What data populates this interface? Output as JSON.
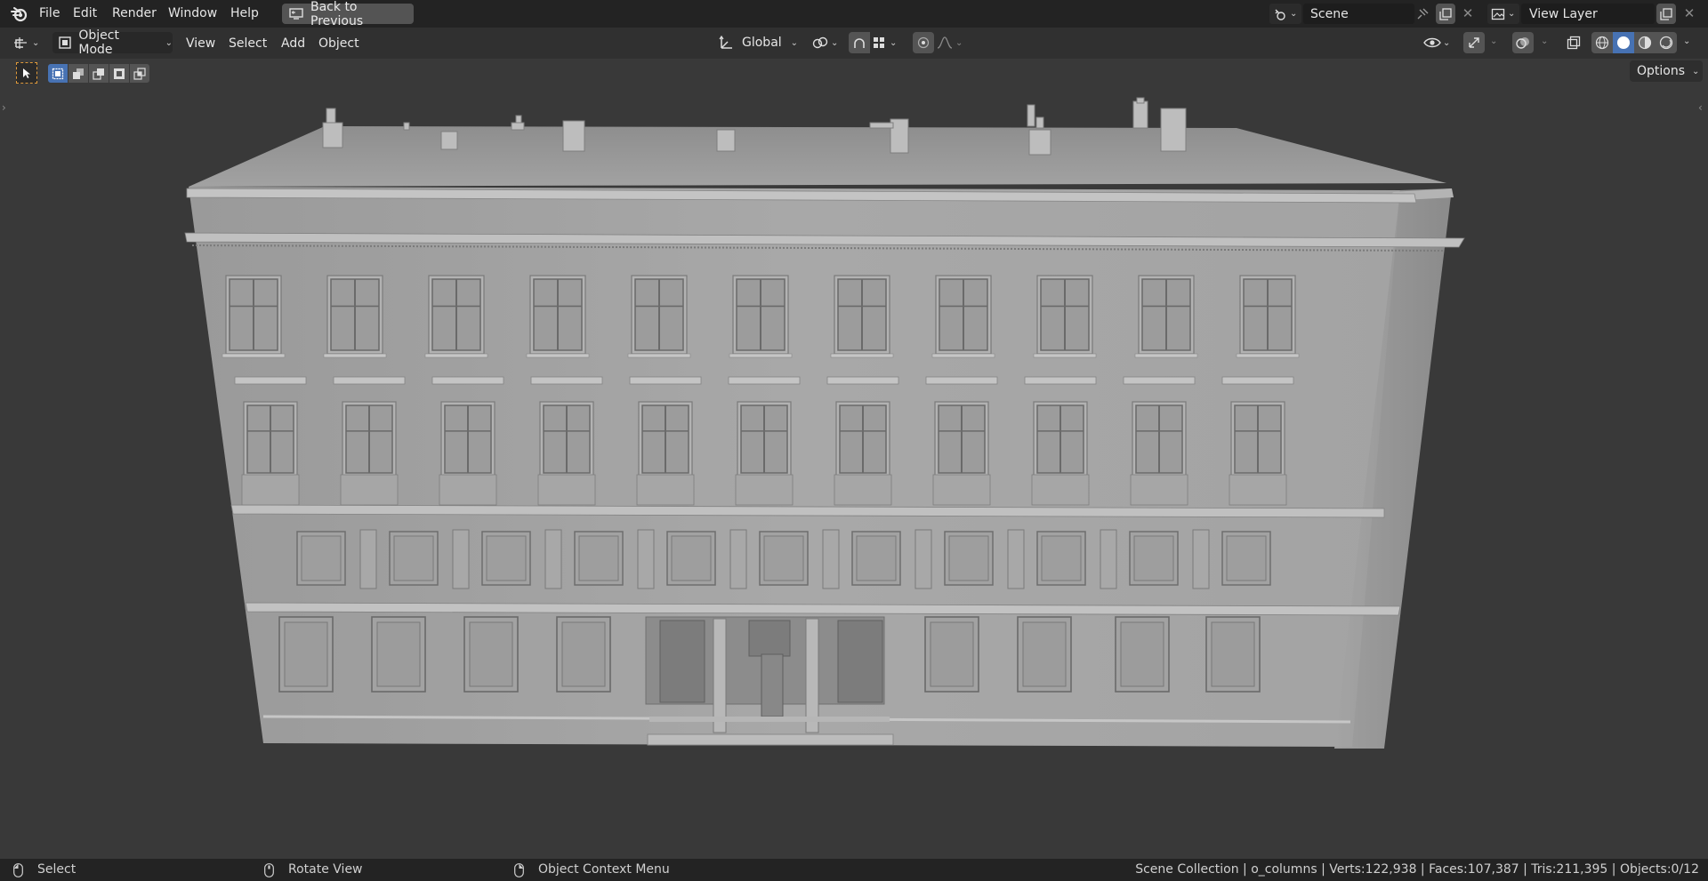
{
  "top_menu": {
    "items": [
      "File",
      "Edit",
      "Render",
      "Window",
      "Help"
    ],
    "back_button": "Back to Previous",
    "scene_label": "Scene",
    "view_layer_label": "View Layer"
  },
  "viewport_header": {
    "mode": "Object Mode",
    "menus": [
      "View",
      "Select",
      "Add",
      "Object"
    ],
    "transform_orientation": "Global",
    "options_label": "Options",
    "shading_mode": "solid"
  },
  "status_bar": {
    "left_hint": "Select",
    "middle_hint": "Rotate View",
    "right_hint": "Object Context Menu",
    "stats": "Scene Collection | o_columns | Verts:122,938 | Faces:107,387 | Tris:211,395 | Objects:0/12"
  },
  "icons": [
    "blender-logo-icon",
    "editor-type-icon",
    "object-mode-icon",
    "transform-orientation-icon",
    "pivot-link-icon",
    "snap-icon",
    "snap-grid-icon",
    "proportional-edit-icon",
    "falloff-icon",
    "visibility-icon",
    "gizmo-icon",
    "overlay-icon",
    "xray-icon",
    "wireframe-shading-icon",
    "solid-shading-icon",
    "material-shading-icon",
    "rendered-shading-icon",
    "select-box-tool-icon",
    "mouse-left-icon",
    "mouse-middle-icon",
    "mouse-right-icon"
  ],
  "colors": {
    "accent_blue": "#4772b3",
    "topbar_bg": "#232323",
    "header_bg": "#303030",
    "viewport_bg": "#393939",
    "selection_outline": "#e09a3a"
  }
}
